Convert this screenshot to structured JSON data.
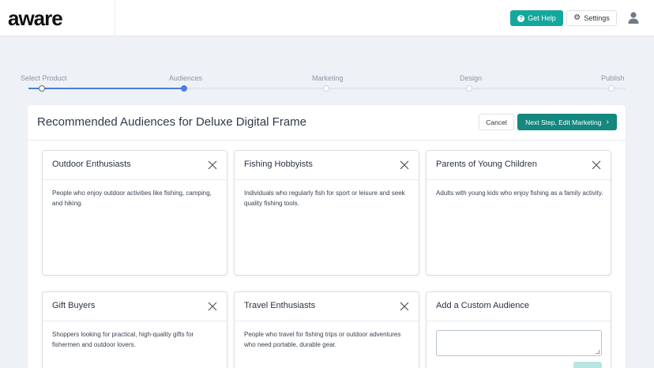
{
  "header": {
    "logo_text": "aware",
    "help_label": "Get Help",
    "settings_label": "Settings"
  },
  "stepper": {
    "steps": [
      {
        "label": "Select Product",
        "state": "done"
      },
      {
        "label": "Audiences",
        "state": "current"
      },
      {
        "label": "Marketing",
        "state": "todo"
      },
      {
        "label": "Design",
        "state": "todo"
      },
      {
        "label": "Publish",
        "state": "todo"
      }
    ]
  },
  "panel": {
    "title": "Recommended Audiences for Deluxe Digital Frame",
    "cancel_label": "Cancel",
    "next_label": "Next Step, Edit Marketing"
  },
  "audiences": [
    {
      "title": "Outdoor Enthusiasts",
      "description": "People who enjoy outdoor activities like fishing, camping, and hiking."
    },
    {
      "title": "Fishing Hobbyists",
      "description": "Individuals who regularly fish for sport or leisure and seek quality fishing tools."
    },
    {
      "title": "Parents of Young Children",
      "description": "Adults with young kids who enjoy fishing as a family activity."
    },
    {
      "title": "Gift Buyers",
      "description": "Shoppers looking for practical, high-quality gifts for fishermen and outdoor lovers."
    },
    {
      "title": "Travel Enthusiasts",
      "description": "People who travel for fishing trips or outdoor adventures who need portable, durable gear."
    }
  ],
  "custom_audience": {
    "title": "Add a Custom Audience",
    "input_value": ""
  },
  "colors": {
    "accent": "#14a79d",
    "primary_button": "#14877f",
    "progress": "#4a7ee0",
    "background": "#eef1f6"
  },
  "icons": {
    "help": "question-circle-icon",
    "settings": "gear-icon",
    "user": "user-icon",
    "close": "close-icon",
    "next": "chevron-right-icon"
  }
}
